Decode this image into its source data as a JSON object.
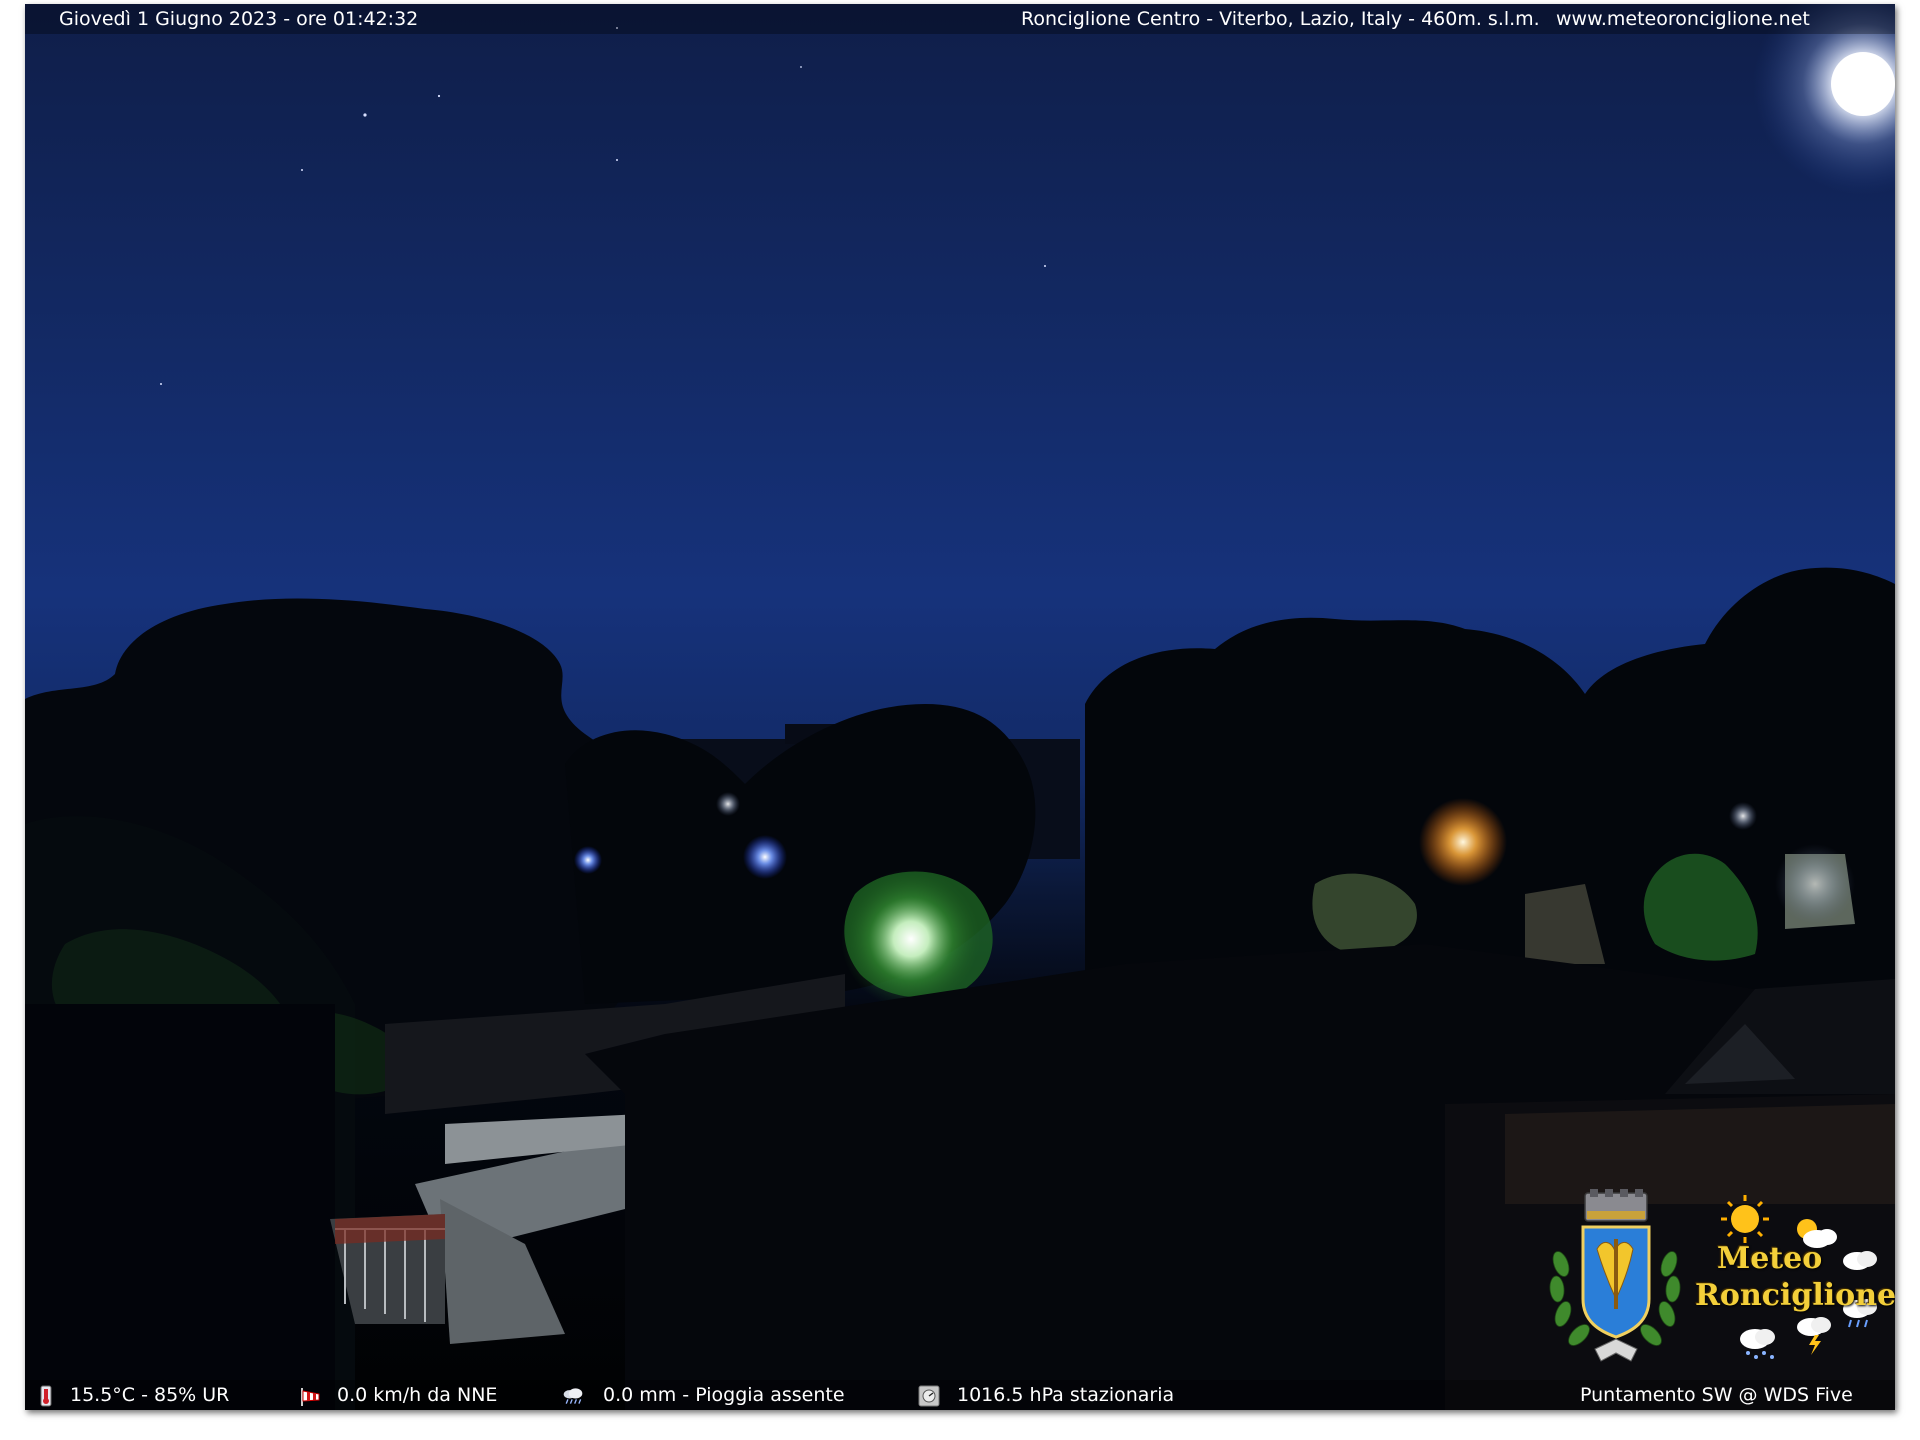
{
  "header": {
    "datetime": "Giovedì 1 Giugno 2023 - ore 01:42:32",
    "location": "Ronciglione Centro - Viterbo, Lazio, Italy - 460m. s.l.m.",
    "website": "www.meteoronciglione.net"
  },
  "footer": {
    "temperature_humidity": "15.5°C - 85% UR",
    "wind": "0.0 km/h da NNE",
    "rain": "0.0 mm - Pioggia assente",
    "pressure": "1016.5 hPa stazionaria",
    "camera": "Puntamento SW  @ WDS Five"
  },
  "logo": {
    "line1": "Meteo",
    "line2": "Ronciglione"
  },
  "icons": {
    "temperature": "thermometer-icon",
    "wind": "windsock-icon",
    "rain": "rain-cloud-icon",
    "pressure": "barometer-icon"
  },
  "colors": {
    "sky_top": "#0f1e49",
    "sky_mid": "#16327b",
    "logo_text": "#f3cf3a"
  }
}
